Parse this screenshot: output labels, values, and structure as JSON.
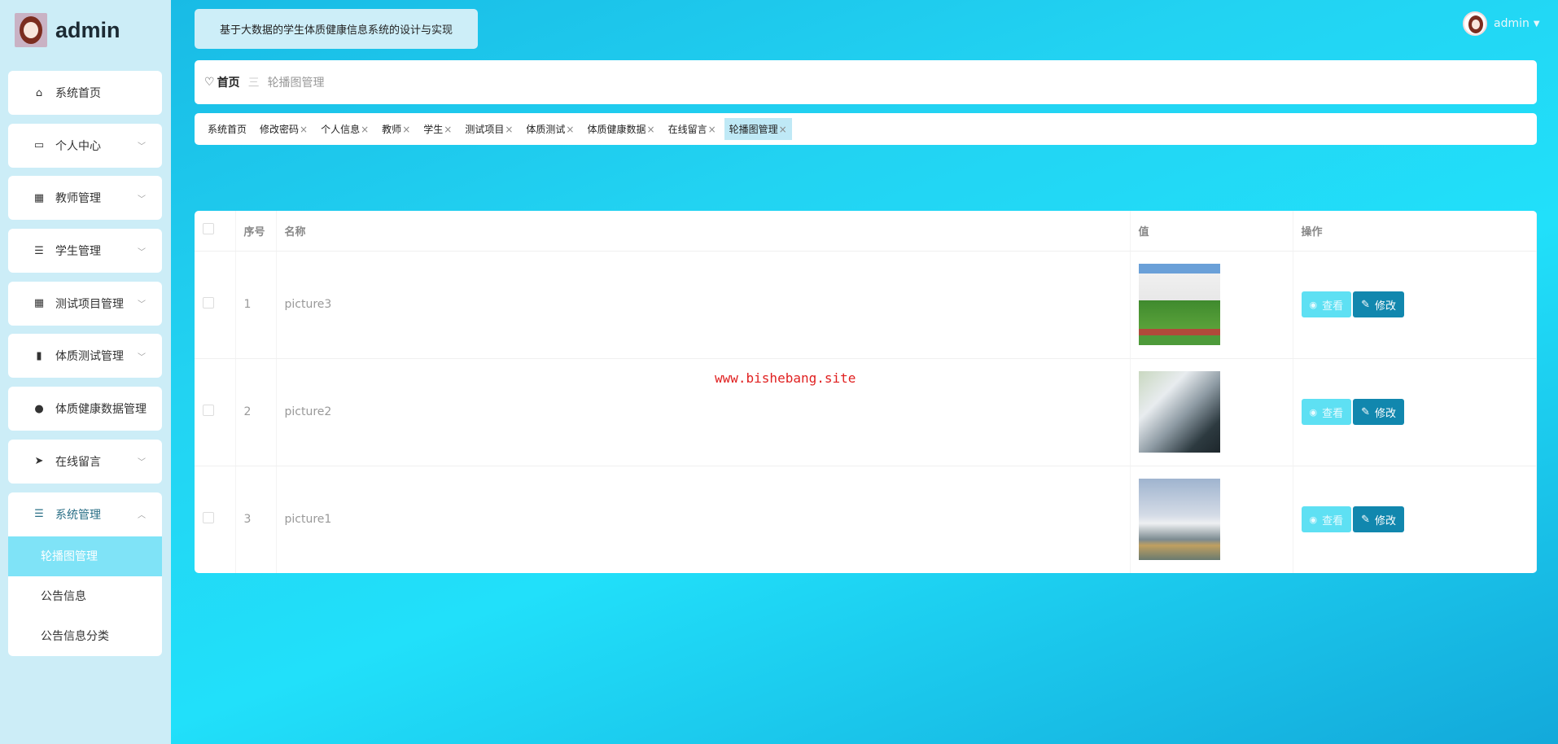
{
  "sidebar": {
    "username": "admin",
    "items": [
      {
        "label": "系统首页",
        "icon": "home-icon"
      },
      {
        "label": "个人中心",
        "icon": "wallet-icon"
      },
      {
        "label": "教师管理",
        "icon": "grid-icon"
      },
      {
        "label": "学生管理",
        "icon": "list-icon"
      },
      {
        "label": "测试项目管理",
        "icon": "grid-icon"
      },
      {
        "label": "体质测试管理",
        "icon": "book-icon"
      },
      {
        "label": "体质健康数据管理",
        "icon": "user-icon"
      },
      {
        "label": "在线留言",
        "icon": "send-icon"
      },
      {
        "label": "系统管理",
        "icon": "list-icon"
      }
    ],
    "submenu": [
      "轮播图管理",
      "公告信息",
      "公告信息分类"
    ]
  },
  "header": {
    "title": "基于大数据的学生体质健康信息系统的设计与实现",
    "user": "admin"
  },
  "breadcrumb": {
    "home": "首页",
    "sep": "三",
    "current": "轮播图管理"
  },
  "tabs": [
    "系统首页",
    "修改密码",
    "个人信息",
    "教师",
    "学生",
    "测试项目",
    "体质测试",
    "体质健康数据",
    "在线留言",
    "轮播图管理"
  ],
  "table": {
    "headers": [
      "序号",
      "名称",
      "值",
      "操作"
    ],
    "rows": [
      {
        "no": "1",
        "name": "picture3"
      },
      {
        "no": "2",
        "name": "picture2"
      },
      {
        "no": "3",
        "name": "picture1"
      }
    ],
    "view_label": "查看",
    "edit_label": "修改"
  },
  "watermark": "www.bishebang.site"
}
